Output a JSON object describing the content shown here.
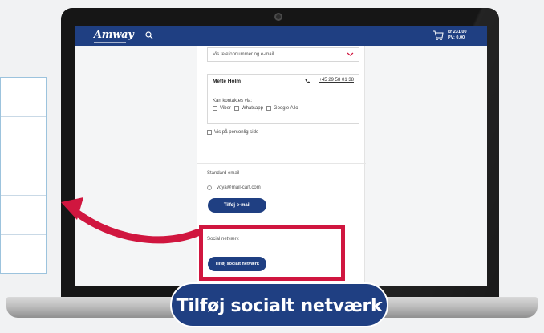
{
  "header": {
    "logo": "Amway",
    "cart_amount": "kr 231,00",
    "cart_pv": "PV: 0,00"
  },
  "contact_select": {
    "value": "Vis telefonnummer og e-mail"
  },
  "contact_card": {
    "name": "Mette Holm",
    "phone": "+45 29 58 01 38",
    "contact_via_label": "Kan kontaktes via:",
    "options": [
      "Viber",
      "Whatsapp",
      "Google Allo"
    ]
  },
  "show_on_page_label": "Vis på personlig side",
  "email_section": {
    "label": "Standard email",
    "email": "voya@mail-cart.com",
    "add_button": "Tilføj e-mail"
  },
  "social_section": {
    "label": "Social netværk",
    "add_button": "Tilføj socialt netværk"
  },
  "callout": {
    "label": "Tilføj socialt netværk"
  },
  "colors": {
    "brand_blue": "#1f3f82",
    "highlight_red": "#d0163f"
  }
}
